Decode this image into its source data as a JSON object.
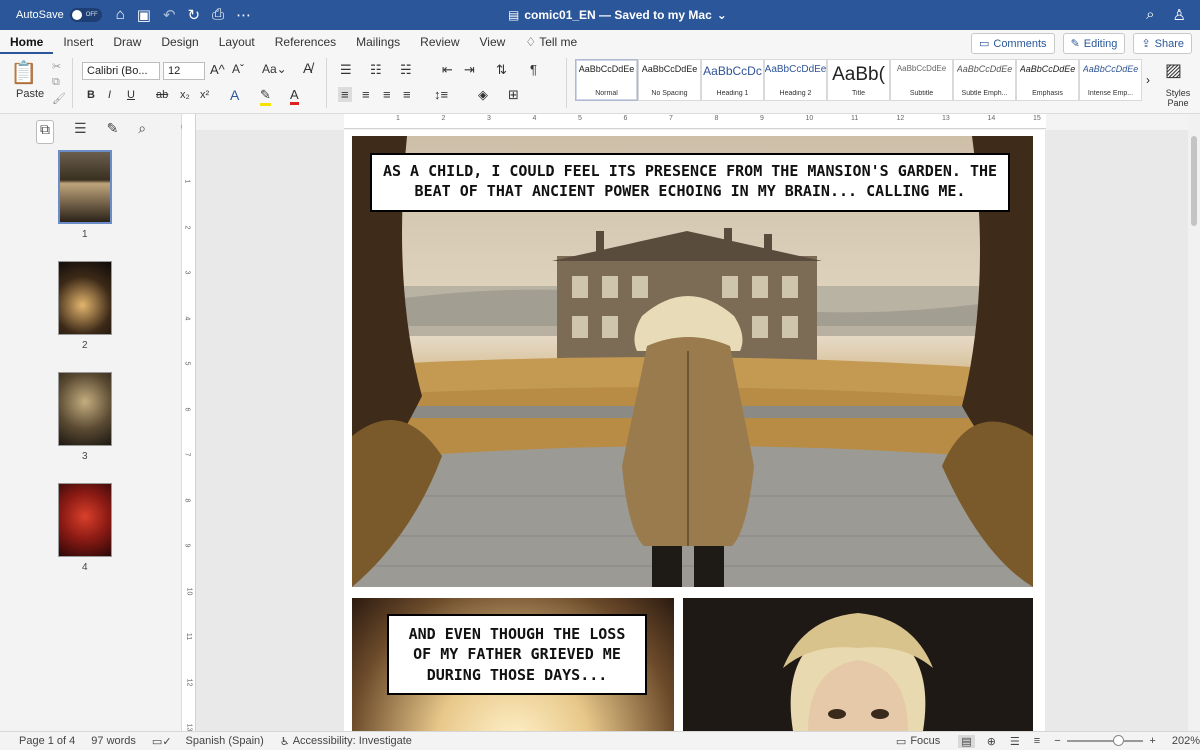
{
  "titlebar": {
    "autosave_label": "AutoSave",
    "autosave_state": "OFF",
    "doc_title": "comic01_EN — Saved to my Mac",
    "bg_color": "#2b579a"
  },
  "tabs": [
    "Home",
    "Insert",
    "Draw",
    "Design",
    "Layout",
    "References",
    "Mailings",
    "Review",
    "View"
  ],
  "tell_me": "Tell me",
  "actions": {
    "comments": "Comments",
    "editing": "Editing",
    "share": "Share"
  },
  "ribbon": {
    "paste_label": "Paste",
    "font_name": "Calibri (Bo...",
    "font_size": "12",
    "styles_pane_label": "Styles Pane",
    "styles": [
      {
        "sample": "AaBbCcDdEe",
        "name": "Normal"
      },
      {
        "sample": "AaBbCcDdEe",
        "name": "No Spacing"
      },
      {
        "sample": "AaBbCcDc",
        "name": "Heading 1"
      },
      {
        "sample": "AaBbCcDdEe",
        "name": "Heading 2"
      },
      {
        "sample": "AaBb(",
        "name": "Title"
      },
      {
        "sample": "AaBbCcDdEe",
        "name": "Subtitle"
      },
      {
        "sample": "AaBbCcDdEe",
        "name": "Subtle Emph..."
      },
      {
        "sample": "AaBbCcDdEe",
        "name": "Emphasis"
      },
      {
        "sample": "AaBbCcDdEe",
        "name": "Intense Emp..."
      }
    ]
  },
  "thumbnails": [
    "1",
    "2",
    "3",
    "4"
  ],
  "ruler": [
    "1",
    "2",
    "3",
    "4",
    "5",
    "6",
    "7",
    "8",
    "9",
    "10",
    "11",
    "12",
    "13",
    "14",
    "15"
  ],
  "comic": {
    "caption1": "AS A CHILD, I COULD FEEL ITS PRESENCE FROM THE MANSION'S GARDEN. THE BEAT OF THAT ANCIENT POWER ECHOING IN MY BRAIN... CALLING ME.",
    "caption2": "AND EVEN THOUGH THE LOSS OF MY FATHER GRIEVED ME DURING THOSE DAYS..."
  },
  "status": {
    "page": "Page 1 of 4",
    "words": "97 words",
    "language": "Spanish (Spain)",
    "accessibility": "Accessibility: Investigate",
    "focus": "Focus",
    "zoom": "202%"
  }
}
